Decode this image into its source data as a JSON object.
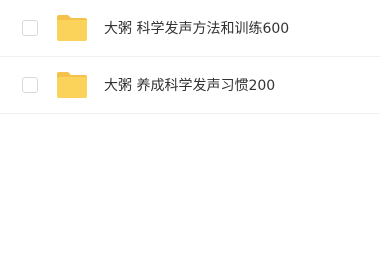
{
  "files": [
    {
      "name": "大粥 科学发声方法和训练600",
      "icon": "folder-icon"
    },
    {
      "name": "大粥 养成科学发声习惯200",
      "icon": "folder-icon"
    }
  ],
  "colors": {
    "folder_body": "#FCD35A",
    "folder_tab": "#F4C24A",
    "divider": "#f0f0f0",
    "checkbox_border": "#d9d9d9",
    "text": "#333333"
  }
}
